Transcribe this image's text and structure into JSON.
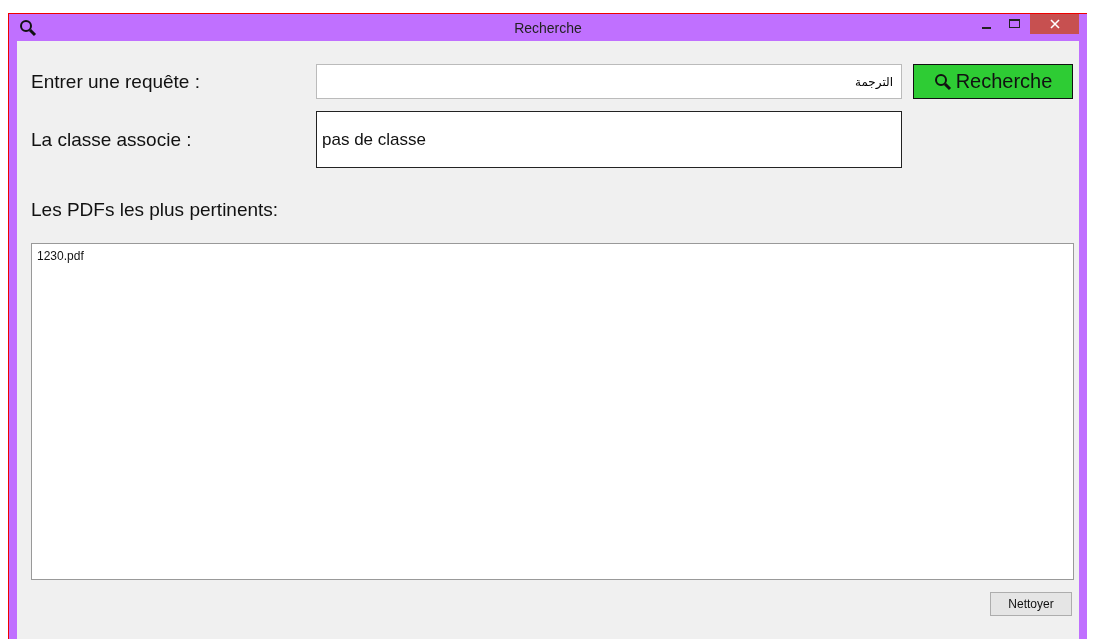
{
  "window": {
    "title": "Recherche"
  },
  "query": {
    "label": "Entrer une requête  :",
    "value": "الترجمة"
  },
  "search_button": {
    "label": "Recherche"
  },
  "class": {
    "label": "La classe associe :",
    "value": "pas de classe"
  },
  "results": {
    "label": "Les PDFs les plus pertinents:",
    "items": [
      "1230.pdf"
    ]
  },
  "clear_button": {
    "label": "Nettoyer"
  }
}
